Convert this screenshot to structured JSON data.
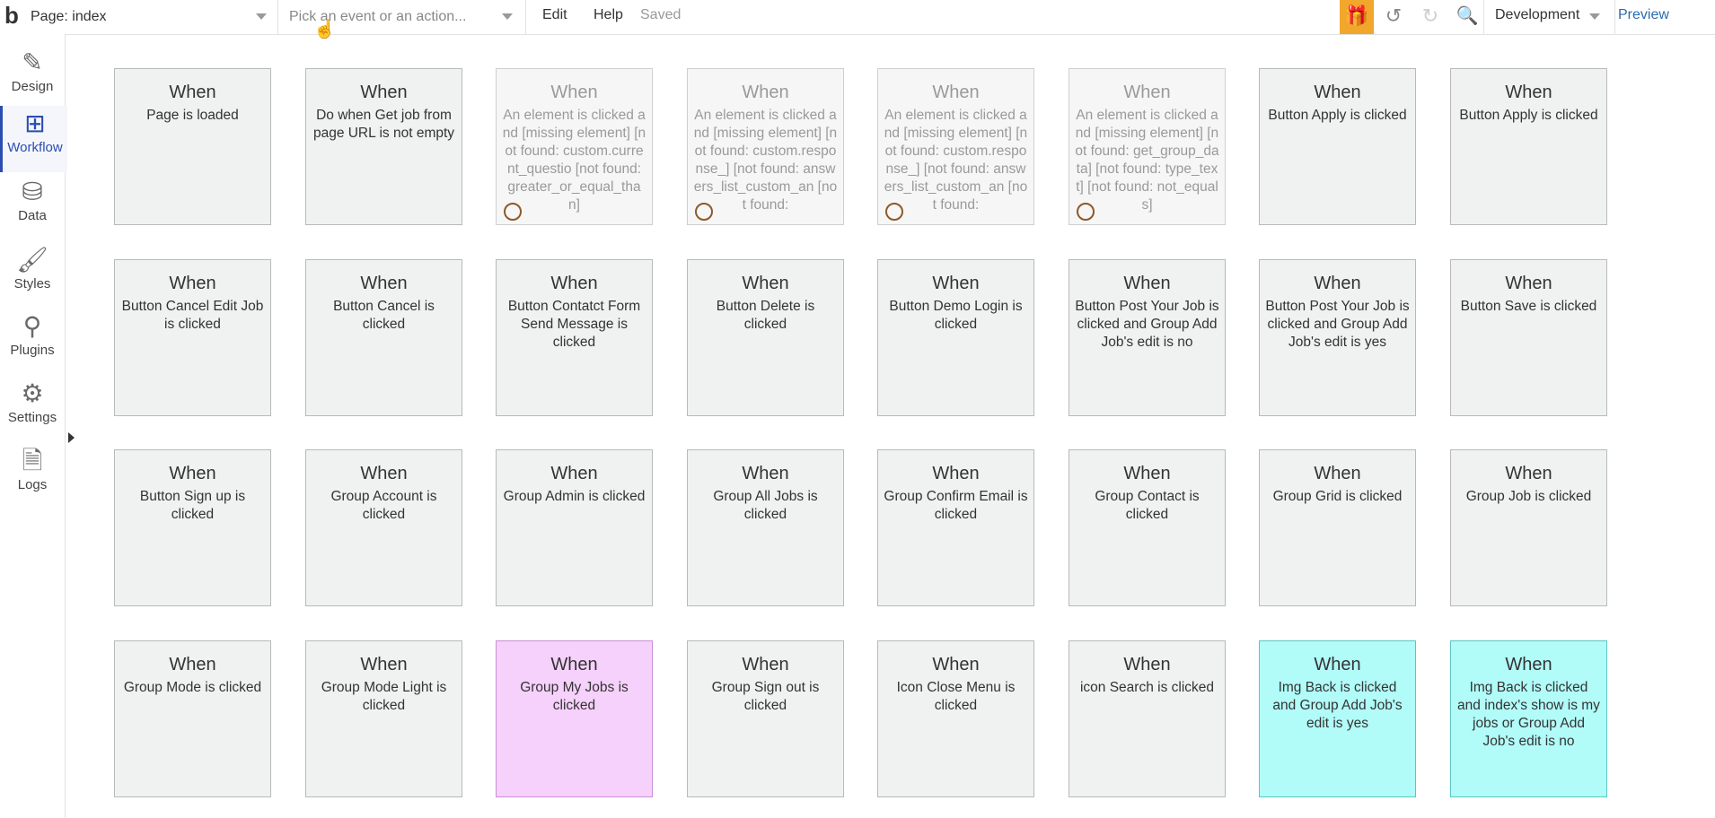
{
  "topbar": {
    "logo": "b",
    "page_selector": "Page: index",
    "event_placeholder": "Pick an event or an action...",
    "menu": {
      "edit": "Edit",
      "help": "Help",
      "saved": "Saved"
    },
    "environment": "Development",
    "preview": "Preview",
    "accent_color": "#f1a72b"
  },
  "sidebar": {
    "items": [
      {
        "label": "Design",
        "icon": "design-icon"
      },
      {
        "label": "Workflow",
        "icon": "workflow-icon"
      },
      {
        "label": "Data",
        "icon": "database-icon"
      },
      {
        "label": "Styles",
        "icon": "brush-icon"
      },
      {
        "label": "Plugins",
        "icon": "plug-icon"
      },
      {
        "label": "Settings",
        "icon": "gear-icon"
      },
      {
        "label": "Logs",
        "icon": "document-icon"
      }
    ],
    "active": "Workflow"
  },
  "workflows": [
    {
      "when": "When",
      "desc": "Page is loaded"
    },
    {
      "when": "When",
      "desc": "Do when Get job from page URL is not empty"
    },
    {
      "when": "When",
      "desc": "An element is clicked and [missing element] [not found: custom.current_questio [not found: greater_or_equal_than]"
    },
    {
      "when": "When",
      "desc": "An element is clicked and [missing element] [not found: custom.response_] [not found: answers_list_custom_an [not found:"
    },
    {
      "when": "When",
      "desc": "An element is clicked and [missing element] [not found: custom.response_] [not found: answers_list_custom_an [not found:"
    },
    {
      "when": "When",
      "desc": "An element is clicked and [missing element] [not found: get_group_data] [not found: type_text] [not found: not_equals]"
    },
    {
      "when": "When",
      "desc": "Button Apply is clicked"
    },
    {
      "when": "When",
      "desc": "Button Apply is clicked"
    },
    {
      "when": "When",
      "desc": "Button Cancel Edit Job is clicked"
    },
    {
      "when": "When",
      "desc": "Button Cancel is clicked"
    },
    {
      "when": "When",
      "desc": "Button Contatct Form Send Message is clicked"
    },
    {
      "when": "When",
      "desc": "Button Delete is clicked"
    },
    {
      "when": "When",
      "desc": "Button Demo Login is clicked"
    },
    {
      "when": "When",
      "desc": "Button Post Your Job is clicked and Group Add Job's edit is no"
    },
    {
      "when": "When",
      "desc": "Button Post Your Job is clicked and Group Add Job's edit is yes"
    },
    {
      "when": "When",
      "desc": "Button Save is clicked"
    },
    {
      "when": "When",
      "desc": "Button Sign up is clicked"
    },
    {
      "when": "When",
      "desc": "Group Account is clicked"
    },
    {
      "when": "When",
      "desc": "Group Admin is clicked"
    },
    {
      "when": "When",
      "desc": "Group All Jobs is clicked"
    },
    {
      "when": "When",
      "desc": "Group Confirm Email is clicked"
    },
    {
      "when": "When",
      "desc": "Group Contact is clicked"
    },
    {
      "when": "When",
      "desc": "Group Grid is clicked"
    },
    {
      "when": "When",
      "desc": "Group Job is clicked"
    },
    {
      "when": "When",
      "desc": "Group Mode is clicked"
    },
    {
      "when": "When",
      "desc": "Group Mode Light is clicked"
    },
    {
      "when": "When",
      "desc": "Group My Jobs is clicked"
    },
    {
      "when": "When",
      "desc": "Group Sign out is clicked"
    },
    {
      "when": "When",
      "desc": "Icon Close Menu is clicked"
    },
    {
      "when": "When",
      "desc": "icon Search is clicked"
    },
    {
      "when": "When",
      "desc": "Img Back is clicked and Group Add Job's edit is yes"
    },
    {
      "when": "When",
      "desc": "Img Back is clicked and index's show is my jobs or Group Add Job's edit is no"
    }
  ]
}
